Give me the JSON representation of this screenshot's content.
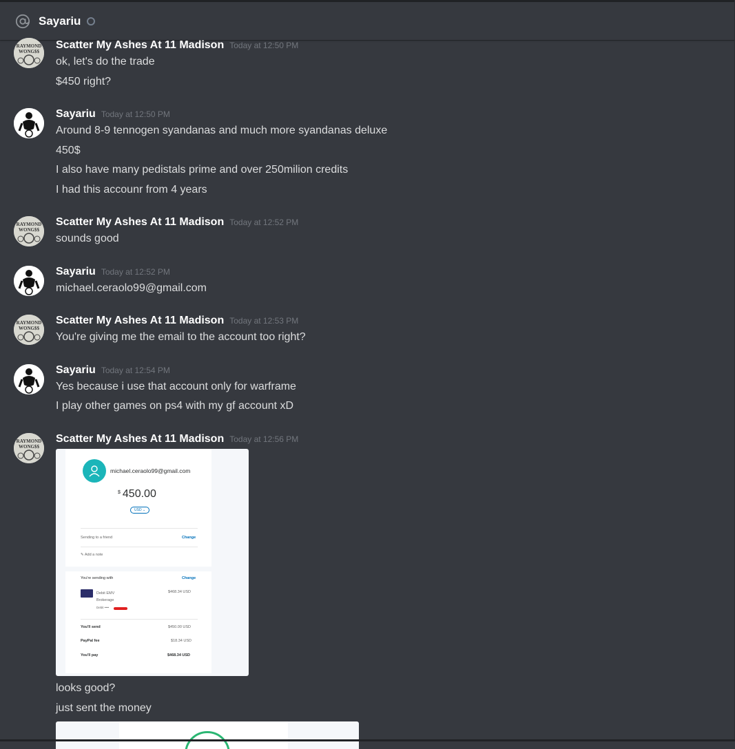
{
  "header": {
    "channel": "Sayariu"
  },
  "users": {
    "scatter": "Scatter My Ashes At 11 Madison",
    "sayariu": "Sayariu"
  },
  "messages": [
    {
      "timestamp": "Today at 12:50 PM",
      "lines": [
        "ok, let's do the trade",
        "$450 right?"
      ]
    },
    {
      "timestamp": "Today at 12:50 PM",
      "lines": [
        "Around 8-9 tennogen syandanas and much more syandanas deluxe",
        "450$",
        "I also have many pedistals prime and over 250milion credits",
        "I had this accounr from 4 years"
      ]
    },
    {
      "timestamp": "Today at 12:52 PM",
      "lines": [
        "sounds good"
      ]
    },
    {
      "timestamp": "Today at 12:52 PM",
      "lines": [
        "michael.ceraolo99@gmail.com"
      ]
    },
    {
      "timestamp": "Today at 12:53 PM",
      "lines": [
        "You're giving me the email to the account too right?"
      ]
    },
    {
      "timestamp": "Today at 12:54 PM",
      "lines": [
        "Yes because i use that account only for warframe",
        "I play other games on ps4 with my gf account xD"
      ]
    },
    {
      "timestamp": "Today at 12:56 PM",
      "lines": [
        "looks good?",
        "just sent the money"
      ]
    }
  ],
  "paypal": {
    "email": "michael.ceraolo99@gmail.com",
    "currency_symbol": "$",
    "amount": "450.00",
    "currency": "USD",
    "sending_to": "Sending to a friend",
    "change": "Change",
    "add_note": "Add a note",
    "sending_with": "You're sending with",
    "card_name_1": "Debit EMV",
    "card_name_2": "Brokerage",
    "card_type": "Debit ••••",
    "card_amount": "$468.34 USD",
    "youll_send_label": "You'll send",
    "youll_send_value": "$450.00 USD",
    "fee_label": "PayPal fee",
    "fee_value": "$18.34 USD",
    "youll_pay_label": "You'll pay",
    "youll_pay_value": "$468.34 USD"
  },
  "colors": {
    "background": "#36393f",
    "username": "#ffffff",
    "text": "#dcddde",
    "timestamp": "#72767d",
    "paypal_blue": "#0070ba",
    "paypal_teal": "#1bb5b9"
  }
}
